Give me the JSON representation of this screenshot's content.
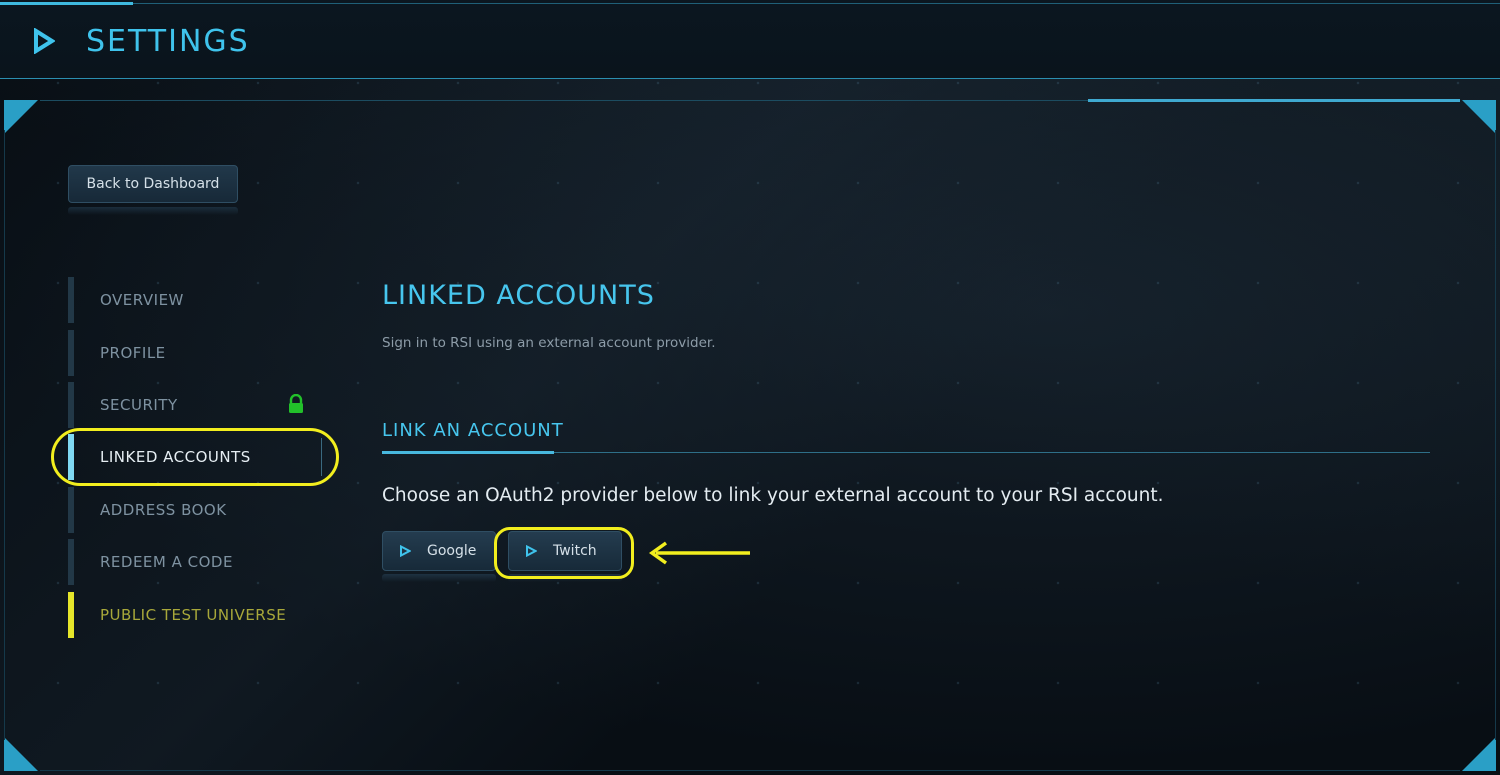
{
  "header": {
    "title": "SETTINGS"
  },
  "back_button": {
    "label": "Back to Dashboard"
  },
  "sidebar": {
    "items": [
      {
        "label": "OVERVIEW"
      },
      {
        "label": "PROFILE"
      },
      {
        "label": "SECURITY"
      },
      {
        "label": "LINKED ACCOUNTS"
      },
      {
        "label": "ADDRESS BOOK"
      },
      {
        "label": "REDEEM A CODE"
      },
      {
        "label": "PUBLIC TEST UNIVERSE"
      }
    ],
    "active_item": "LINKED ACCOUNTS"
  },
  "main": {
    "title": "LINKED ACCOUNTS",
    "subtitle": "Sign in to RSI using an external account provider.",
    "section_title": "LINK AN ACCOUNT",
    "instructions": "Choose an OAuth2 provider below to link your external account to your RSI account.",
    "providers": [
      {
        "label": "Google"
      },
      {
        "label": "Twitch"
      }
    ]
  },
  "icons": {
    "header": "play-triangle-icon",
    "security": "lock-icon",
    "provider": "play-triangle-icon",
    "annotation": "arrow-left-icon"
  },
  "colors": {
    "accent": "#3fc3ec",
    "highlight": "#f2ee1e",
    "lock": "#22c02a",
    "ptu": "#e6e62a"
  }
}
